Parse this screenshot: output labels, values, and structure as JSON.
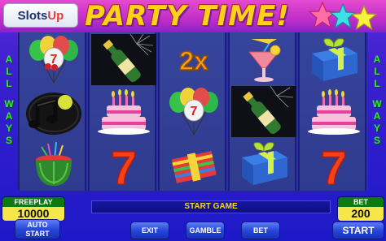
{
  "header": {
    "logo_left": "Slots",
    "logo_right": "Up",
    "title": "PARTY TIME!"
  },
  "side_left": [
    "A",
    "L",
    "L",
    "",
    "W",
    "A",
    "Y",
    "S"
  ],
  "side_right": [
    "A",
    "L",
    "L",
    "",
    "W",
    "A",
    "Y",
    "S"
  ],
  "reels": [
    [
      "balloons",
      "music-notes",
      "watermelon-cocktail"
    ],
    [
      "champagne-bottle",
      "birthday-cake",
      "seven"
    ],
    [
      "multiplier-2x",
      "balloons",
      "party-favor"
    ],
    [
      "cocktail-glass",
      "champagne-bottle",
      "gift-box"
    ],
    [
      "gift-box",
      "birthday-cake",
      "seven"
    ]
  ],
  "symbols": {
    "multiplier_text": "2x",
    "seven_text": "7"
  },
  "freeplay": {
    "label": "FREEPLAY",
    "value": "10000"
  },
  "bet": {
    "label": "BET",
    "value": "200"
  },
  "message": "START GAME",
  "buttons": {
    "auto_line1": "AUTO",
    "auto_line2": "START",
    "exit": "EXIT",
    "gamble": "GAMBLE",
    "bet": "BET",
    "start": "START"
  },
  "colors": {
    "accent_yellow": "#ffd21a",
    "side_label_green": "#33e644",
    "banner_pink": "#c02ec9",
    "button_blue": "#2443d8"
  }
}
